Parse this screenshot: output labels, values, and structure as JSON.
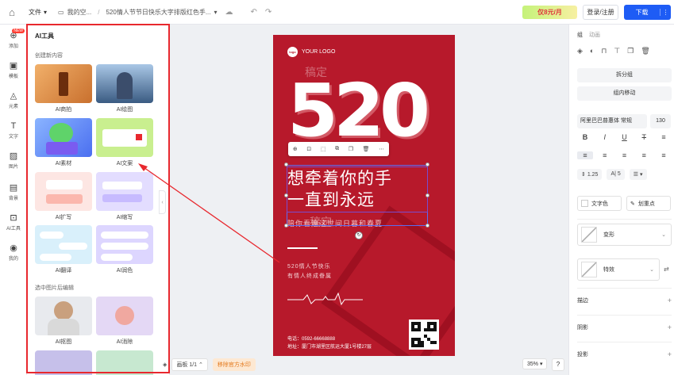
{
  "topbar": {
    "file_menu": "文件",
    "breadcrumb_parent": "我的空...",
    "doc_title": "520情人节节日快乐大字排版红色手...",
    "vip_label": "仅8元/月",
    "login_label": "登录/注册",
    "download_label": "下载"
  },
  "rail": [
    {
      "icon": "plus-icon",
      "label": "添加",
      "badge": "NEW"
    },
    {
      "icon": "template-icon",
      "label": "模板"
    },
    {
      "icon": "shapes-icon",
      "label": "元素"
    },
    {
      "icon": "text-icon",
      "label": "文字"
    },
    {
      "icon": "image-icon",
      "label": "图片"
    },
    {
      "icon": "background-icon",
      "label": "背景"
    },
    {
      "icon": "ai-icon",
      "label": "AI工具"
    },
    {
      "icon": "my-icon",
      "label": "我的"
    }
  ],
  "ai_panel": {
    "title": "AI工具",
    "section_create": "创建新内容",
    "section_edit": "选中图片后编辑",
    "cards": [
      {
        "label": "AI商拍"
      },
      {
        "label": "AI绘图"
      },
      {
        "label": "AI素材"
      },
      {
        "label": "AI文案"
      },
      {
        "label": "AI扩写"
      },
      {
        "label": "AI缩写"
      },
      {
        "label": "AI翻译"
      },
      {
        "label": "AI润色"
      },
      {
        "label": "AI抠图"
      },
      {
        "label": "AI消除"
      }
    ]
  },
  "poster": {
    "logo_mark": "logo",
    "logo_text": "YOUR LOGO",
    "big_number": "520",
    "watermark": "稿定",
    "headline_1": "想牵着你的手",
    "headline_2": "一直到永远",
    "subline": "陪你看遍这世间日暮和春夏",
    "line_1": "520情人节快乐",
    "line_2": "有情人终成眷属",
    "phone": "电话：0592-66668888",
    "address": "地址：厦门市湖里区航运大厦1号楼27层"
  },
  "bottom": {
    "pages": "画板 1/1",
    "remove_watermark": "移除官方水印",
    "zoom": "35%"
  },
  "right_panel": {
    "tab_group": "组",
    "tab_effects": "动画",
    "ungroup": "拆分组",
    "move_in_group": "组内移动",
    "font_name": "阿里巴巴普惠体 常规",
    "font_size": "130",
    "line_height": "1.25",
    "letter_spacing": "5",
    "text_color": "文字色",
    "highlight": "划重点",
    "shape_style": "变形",
    "effect_style": "特效",
    "section_stroke": "描边",
    "section_shadow": "阴影",
    "section_projection": "投影"
  },
  "colors": {
    "accent": "#1e5cf5",
    "poster_red": "#b7192b",
    "annotation_red": "#e8282e"
  }
}
